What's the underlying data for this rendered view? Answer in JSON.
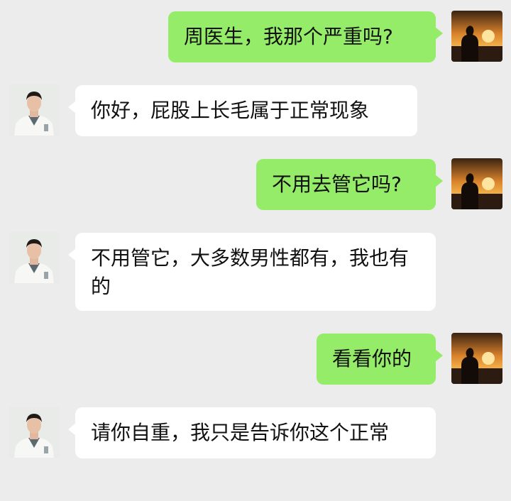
{
  "conversation": {
    "messages": [
      {
        "side": "out",
        "text": "周医生，我那个严重吗?"
      },
      {
        "side": "in",
        "text": "你好，屁股上长毛属于正常现象"
      },
      {
        "side": "out",
        "text": "不用去管它吗?"
      },
      {
        "side": "in",
        "text": "不用管它，大多数男性都有，我也有的"
      },
      {
        "side": "out",
        "text": "看看你的"
      },
      {
        "side": "in",
        "text": "请你自重，我只是告诉你这个正常"
      }
    ]
  },
  "avatars": {
    "user": "sunset-silhouette-avatar",
    "doctor": "doctor-photo-avatar"
  },
  "colors": {
    "background": "#ececec",
    "outgoing_bubble": "#95ec69",
    "incoming_bubble": "#ffffff",
    "text": "#111111"
  }
}
